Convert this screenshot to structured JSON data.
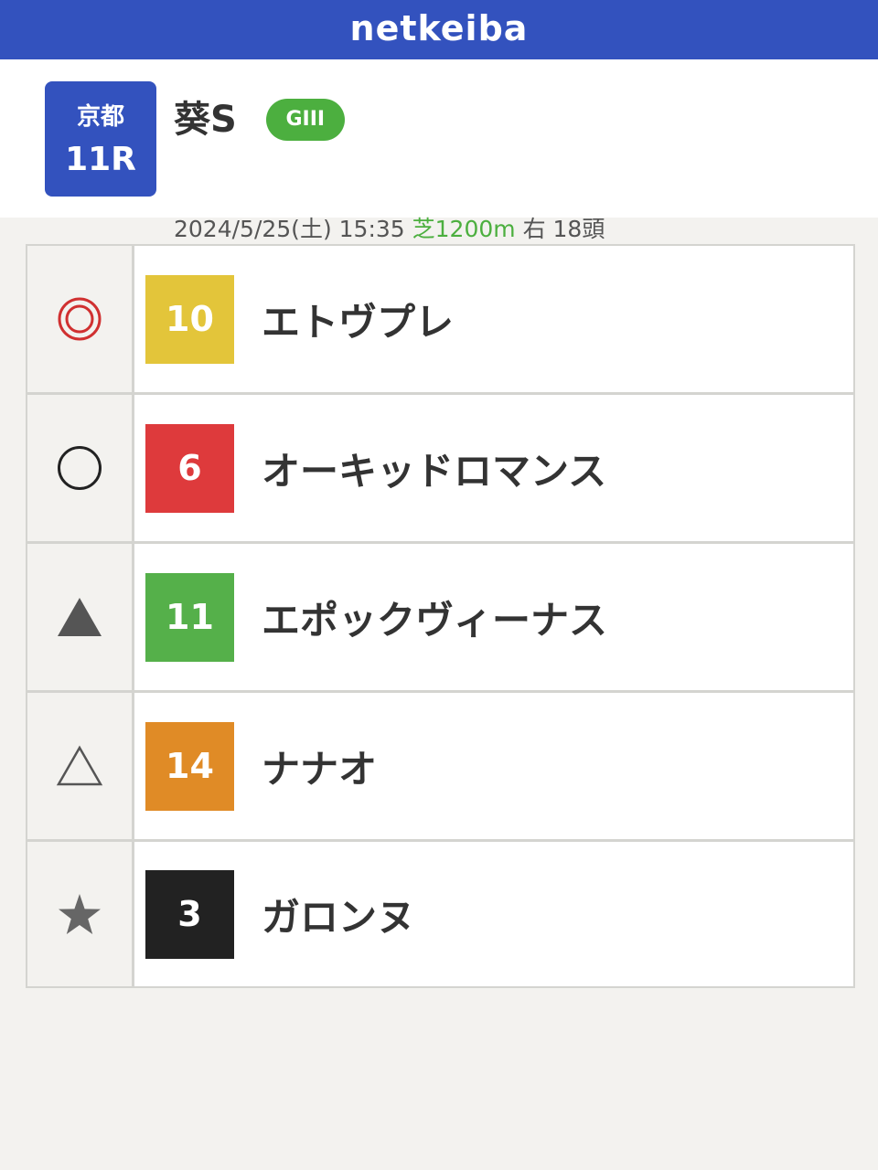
{
  "header": {
    "logo": "netkeiba"
  },
  "race": {
    "venue": "京都",
    "number": "11R",
    "name": "葵S",
    "grade": "GIII",
    "datetime": "2024/5/25(土) 15:35",
    "surface_distance": "芝1200m",
    "direction_runners": "右 18頭"
  },
  "predictions": [
    {
      "mark": "double-circle-icon",
      "number": "10",
      "name": "エトヴプレ",
      "color": "#e3c53a"
    },
    {
      "mark": "circle-icon",
      "number": "6",
      "name": "オーキッドロマンス",
      "color": "#de3a3c"
    },
    {
      "mark": "filled-triangle-icon",
      "number": "11",
      "name": "エポックヴィーナス",
      "color": "#55b04a"
    },
    {
      "mark": "open-triangle-icon",
      "number": "14",
      "name": "ナナオ",
      "color": "#e08b26"
    },
    {
      "mark": "star-icon",
      "number": "3",
      "name": "ガロンヌ",
      "color": "#222222"
    }
  ],
  "colors": {
    "brand": "#3352be",
    "turf": "#4caf3f",
    "mark_red": "#d03030"
  }
}
